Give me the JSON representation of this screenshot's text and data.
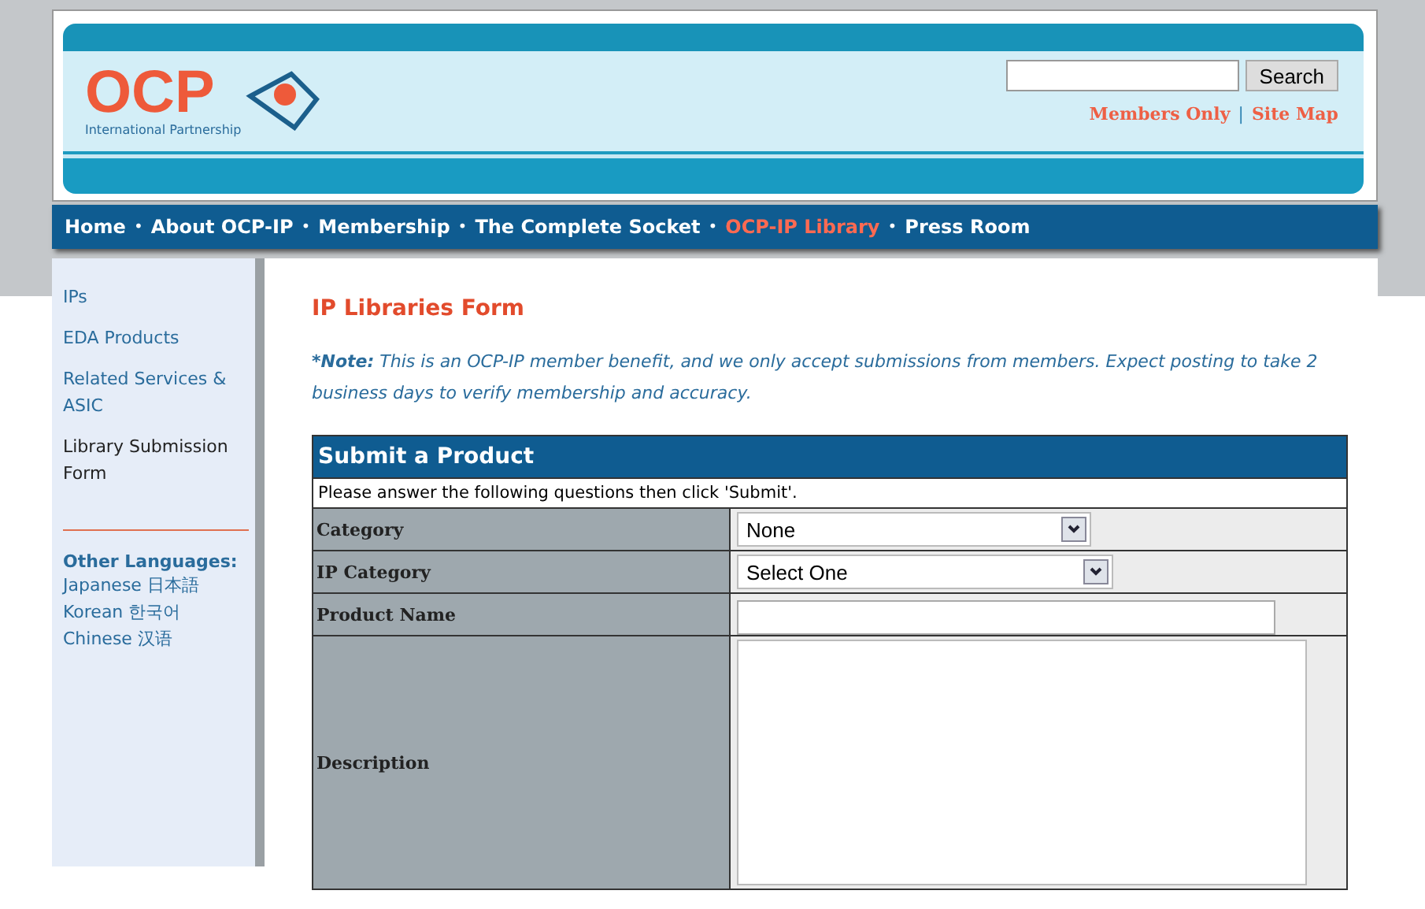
{
  "header": {
    "logo_text": "OCP",
    "logo_subtitle": "International Partnership",
    "search": {
      "button": "Search"
    },
    "links": [
      "Members Only",
      "Site Map"
    ],
    "link_separator": "|"
  },
  "nav": [
    {
      "label": "Home",
      "selected": false
    },
    {
      "label": "About OCP-IP",
      "selected": false
    },
    {
      "label": "Membership",
      "selected": false
    },
    {
      "label": "The Complete Socket",
      "selected": false
    },
    {
      "label": "OCP-IP Library",
      "selected": true
    },
    {
      "label": "Press Room",
      "selected": false
    }
  ],
  "nav_separator": "•",
  "sidebar": {
    "items": [
      {
        "label": "IPs",
        "selected": false
      },
      {
        "label": "EDA Products",
        "selected": false
      },
      {
        "label": "Related Services & ASIC",
        "selected": false
      },
      {
        "label": "Library Submission Form",
        "selected": true
      }
    ],
    "languages_heading": "Other Languages:",
    "languages": [
      "Japanese 日本語",
      "Korean 한국어",
      "Chinese 汉语"
    ]
  },
  "main": {
    "title": "IP Libraries Form",
    "note_label": "*Note:",
    "note": "This is an OCP-IP member benefit, and we only accept submissions from members. Expect posting to take 2 business days to verify membership and accuracy.",
    "form": {
      "title": "Submit a Product",
      "instructions": "Please answer the following questions then click 'Submit'.",
      "fields": [
        {
          "label": "Category",
          "kind": "select",
          "value": "None"
        },
        {
          "label": "IP Category",
          "kind": "select",
          "value": "Select One"
        },
        {
          "label": "Product Name",
          "kind": "text"
        },
        {
          "label": "Description",
          "kind": "textarea"
        }
      ]
    }
  }
}
